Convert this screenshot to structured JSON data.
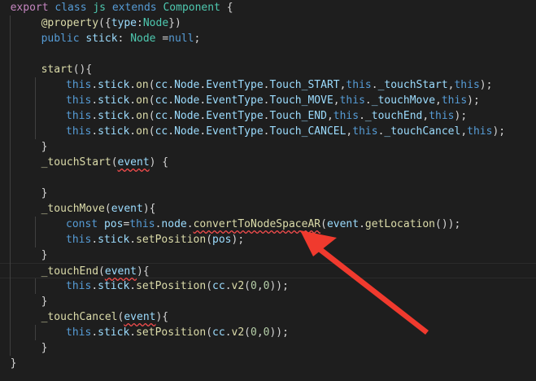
{
  "editor": {
    "lines": [
      {
        "indent": 1,
        "tokens": [
          [
            "export",
            "ctl"
          ],
          [
            " ",
            "pl"
          ],
          [
            "class",
            "kw"
          ],
          [
            " ",
            "pl"
          ],
          [
            "js",
            "cls"
          ],
          [
            " ",
            "pl"
          ],
          [
            "extends",
            "kw"
          ],
          [
            " ",
            "pl"
          ],
          [
            "Component",
            "cls"
          ],
          [
            " {",
            "pl"
          ]
        ]
      },
      {
        "indent": 6,
        "tokens": [
          [
            "@property",
            "dec"
          ],
          [
            "({",
            "pl"
          ],
          [
            "type",
            "var"
          ],
          [
            ":",
            "pl"
          ],
          [
            "Node",
            "cls"
          ],
          [
            "})",
            "pl"
          ]
        ]
      },
      {
        "indent": 6,
        "tokens": [
          [
            "public",
            "kw"
          ],
          [
            " ",
            "pl"
          ],
          [
            "stick",
            "var"
          ],
          [
            ": ",
            "pl"
          ],
          [
            "Node",
            "cls"
          ],
          [
            " =",
            "pl"
          ],
          [
            "null",
            "kw"
          ],
          [
            ";",
            "pl"
          ]
        ]
      },
      {
        "indent": 0,
        "tokens": []
      },
      {
        "indent": 6,
        "tokens": [
          [
            "start",
            "fn"
          ],
          [
            "(){",
            "pl"
          ]
        ]
      },
      {
        "indent": 10,
        "tokens": [
          [
            "this",
            "kw"
          ],
          [
            ".",
            "pl"
          ],
          [
            "stick",
            "var"
          ],
          [
            ".",
            "pl"
          ],
          [
            "on",
            "fn"
          ],
          [
            "(",
            "pl"
          ],
          [
            "cc",
            "var"
          ],
          [
            ".",
            "pl"
          ],
          [
            "Node",
            "var"
          ],
          [
            ".",
            "pl"
          ],
          [
            "EventType",
            "var"
          ],
          [
            ".",
            "pl"
          ],
          [
            "Touch_START",
            "var"
          ],
          [
            ",",
            "pl"
          ],
          [
            "this",
            "kw"
          ],
          [
            ".",
            "pl"
          ],
          [
            "_touchStart",
            "var"
          ],
          [
            ",",
            "pl"
          ],
          [
            "this",
            "kw"
          ],
          [
            ");",
            "pl"
          ]
        ]
      },
      {
        "indent": 10,
        "tokens": [
          [
            "this",
            "kw"
          ],
          [
            ".",
            "pl"
          ],
          [
            "stick",
            "var"
          ],
          [
            ".",
            "pl"
          ],
          [
            "on",
            "fn"
          ],
          [
            "(",
            "pl"
          ],
          [
            "cc",
            "var"
          ],
          [
            ".",
            "pl"
          ],
          [
            "Node",
            "var"
          ],
          [
            ".",
            "pl"
          ],
          [
            "EventType",
            "var"
          ],
          [
            ".",
            "pl"
          ],
          [
            "Touch_MOVE",
            "var"
          ],
          [
            ",",
            "pl"
          ],
          [
            "this",
            "kw"
          ],
          [
            ".",
            "pl"
          ],
          [
            "_touchMove",
            "var"
          ],
          [
            ",",
            "pl"
          ],
          [
            "this",
            "kw"
          ],
          [
            ");",
            "pl"
          ]
        ]
      },
      {
        "indent": 10,
        "tokens": [
          [
            "this",
            "kw"
          ],
          [
            ".",
            "pl"
          ],
          [
            "stick",
            "var"
          ],
          [
            ".",
            "pl"
          ],
          [
            "on",
            "fn"
          ],
          [
            "(",
            "pl"
          ],
          [
            "cc",
            "var"
          ],
          [
            ".",
            "pl"
          ],
          [
            "Node",
            "var"
          ],
          [
            ".",
            "pl"
          ],
          [
            "EventType",
            "var"
          ],
          [
            ".",
            "pl"
          ],
          [
            "Touch_END",
            "var"
          ],
          [
            ",",
            "pl"
          ],
          [
            "this",
            "kw"
          ],
          [
            ".",
            "pl"
          ],
          [
            "_touchEnd",
            "var"
          ],
          [
            ",",
            "pl"
          ],
          [
            "this",
            "kw"
          ],
          [
            ");",
            "pl"
          ]
        ]
      },
      {
        "indent": 10,
        "tokens": [
          [
            "this",
            "kw"
          ],
          [
            ".",
            "pl"
          ],
          [
            "stick",
            "var"
          ],
          [
            ".",
            "pl"
          ],
          [
            "on",
            "fn"
          ],
          [
            "(",
            "pl"
          ],
          [
            "cc",
            "var"
          ],
          [
            ".",
            "pl"
          ],
          [
            "Node",
            "var"
          ],
          [
            ".",
            "pl"
          ],
          [
            "EventType",
            "var"
          ],
          [
            ".",
            "pl"
          ],
          [
            "Touch_CANCEL",
            "var"
          ],
          [
            ",",
            "pl"
          ],
          [
            "this",
            "kw"
          ],
          [
            ".",
            "pl"
          ],
          [
            "_touchCancel",
            "var"
          ],
          [
            ",",
            "pl"
          ],
          [
            "this",
            "kw"
          ],
          [
            ");",
            "pl"
          ]
        ]
      },
      {
        "indent": 6,
        "tokens": [
          [
            "}",
            "pl"
          ]
        ]
      },
      {
        "indent": 6,
        "tokens": [
          [
            "_touchStart",
            "fn"
          ],
          [
            "(",
            "pl"
          ],
          [
            "event",
            "var err"
          ],
          [
            ") {",
            "pl"
          ]
        ]
      },
      {
        "indent": 0,
        "tokens": []
      },
      {
        "indent": 6,
        "tokens": [
          [
            "}",
            "pl"
          ]
        ]
      },
      {
        "indent": 6,
        "tokens": [
          [
            "_touchMove",
            "fn"
          ],
          [
            "(",
            "pl"
          ],
          [
            "event",
            "var"
          ],
          [
            "){",
            "pl"
          ]
        ]
      },
      {
        "indent": 10,
        "tokens": [
          [
            "const",
            "kw"
          ],
          [
            " ",
            "pl"
          ],
          [
            "pos",
            "var"
          ],
          [
            "=",
            "pl"
          ],
          [
            "this",
            "kw"
          ],
          [
            ".",
            "pl"
          ],
          [
            "node",
            "var"
          ],
          [
            ".",
            "pl"
          ],
          [
            "convertToNodeSpaceAR",
            "fn err"
          ],
          [
            "(",
            "pl"
          ],
          [
            "event",
            "var"
          ],
          [
            ".",
            "pl"
          ],
          [
            "getLocation",
            "fn"
          ],
          [
            "());",
            "pl"
          ]
        ]
      },
      {
        "indent": 10,
        "tokens": [
          [
            "this",
            "kw"
          ],
          [
            ".",
            "pl"
          ],
          [
            "stick",
            "var"
          ],
          [
            ".",
            "pl"
          ],
          [
            "setPosition",
            "fn"
          ],
          [
            "(",
            "pl"
          ],
          [
            "pos",
            "var"
          ],
          [
            ");",
            "pl"
          ]
        ]
      },
      {
        "indent": 6,
        "tokens": [
          [
            "}",
            "pl"
          ]
        ]
      },
      {
        "indent": 6,
        "tokens": [
          [
            "_touchEnd",
            "fn"
          ],
          [
            "(",
            "pl"
          ],
          [
            "event",
            "var err"
          ],
          [
            "){",
            "pl"
          ]
        ]
      },
      {
        "indent": 10,
        "tokens": [
          [
            "this",
            "kw"
          ],
          [
            ".",
            "pl"
          ],
          [
            "stick",
            "var"
          ],
          [
            ".",
            "pl"
          ],
          [
            "setPosition",
            "fn"
          ],
          [
            "(",
            "pl"
          ],
          [
            "cc",
            "var"
          ],
          [
            ".",
            "pl"
          ],
          [
            "v2",
            "fn"
          ],
          [
            "(",
            "pl"
          ],
          [
            "0",
            "num"
          ],
          [
            ",",
            "pl"
          ],
          [
            "0",
            "num"
          ],
          [
            "));",
            "pl"
          ]
        ]
      },
      {
        "indent": 6,
        "tokens": [
          [
            "}",
            "pl"
          ]
        ]
      },
      {
        "indent": 6,
        "tokens": [
          [
            "_touchCancel",
            "fn"
          ],
          [
            "(",
            "pl"
          ],
          [
            "event",
            "var err"
          ],
          [
            "){",
            "pl"
          ]
        ]
      },
      {
        "indent": 10,
        "tokens": [
          [
            "this",
            "kw"
          ],
          [
            ".",
            "pl"
          ],
          [
            "stick",
            "var"
          ],
          [
            ".",
            "pl"
          ],
          [
            "setPosition",
            "fn"
          ],
          [
            "(",
            "pl"
          ],
          [
            "cc",
            "var"
          ],
          [
            ".",
            "pl"
          ],
          [
            "v2",
            "fn"
          ],
          [
            "(",
            "pl"
          ],
          [
            "0",
            "num"
          ],
          [
            ",",
            "pl"
          ],
          [
            "0",
            "num"
          ],
          [
            "));",
            "pl"
          ]
        ]
      },
      {
        "indent": 6,
        "tokens": [
          [
            "}",
            "pl"
          ]
        ]
      },
      {
        "indent": 1,
        "tokens": [
          [
            "}",
            "pl"
          ]
        ]
      }
    ]
  },
  "annotation": {
    "arrow_color": "#f03a2e",
    "icon": "red-arrow-annotation"
  }
}
